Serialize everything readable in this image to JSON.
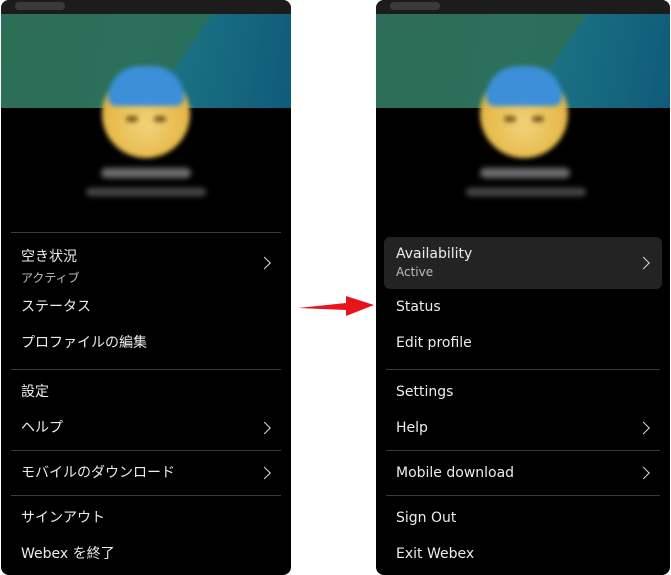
{
  "left_menu": {
    "availability": {
      "label": "空き状況",
      "sub": "アクティブ"
    },
    "status": "ステータス",
    "edit_profile": "プロファイルの編集",
    "settings": "設定",
    "help": "ヘルプ",
    "mobile_download": "モバイルのダウンロード",
    "sign_out": "サインアウト",
    "exit": "Webex を終了"
  },
  "right_menu": {
    "availability": {
      "label": "Availability",
      "sub": "Active"
    },
    "status": "Status",
    "edit_profile": "Edit profile",
    "settings": "Settings",
    "help": "Help",
    "mobile_download": "Mobile download",
    "sign_out": "Sign Out",
    "exit": "Exit Webex"
  },
  "colors": {
    "panel_bg": "#000000",
    "text": "#ececec",
    "arrow": "#e8141c",
    "banner_start": "#2e6a5c",
    "banner_end": "#0f5b7a"
  },
  "icons": [
    "chevron-right-icon",
    "red-arrow-icon",
    "avatar-image"
  ]
}
